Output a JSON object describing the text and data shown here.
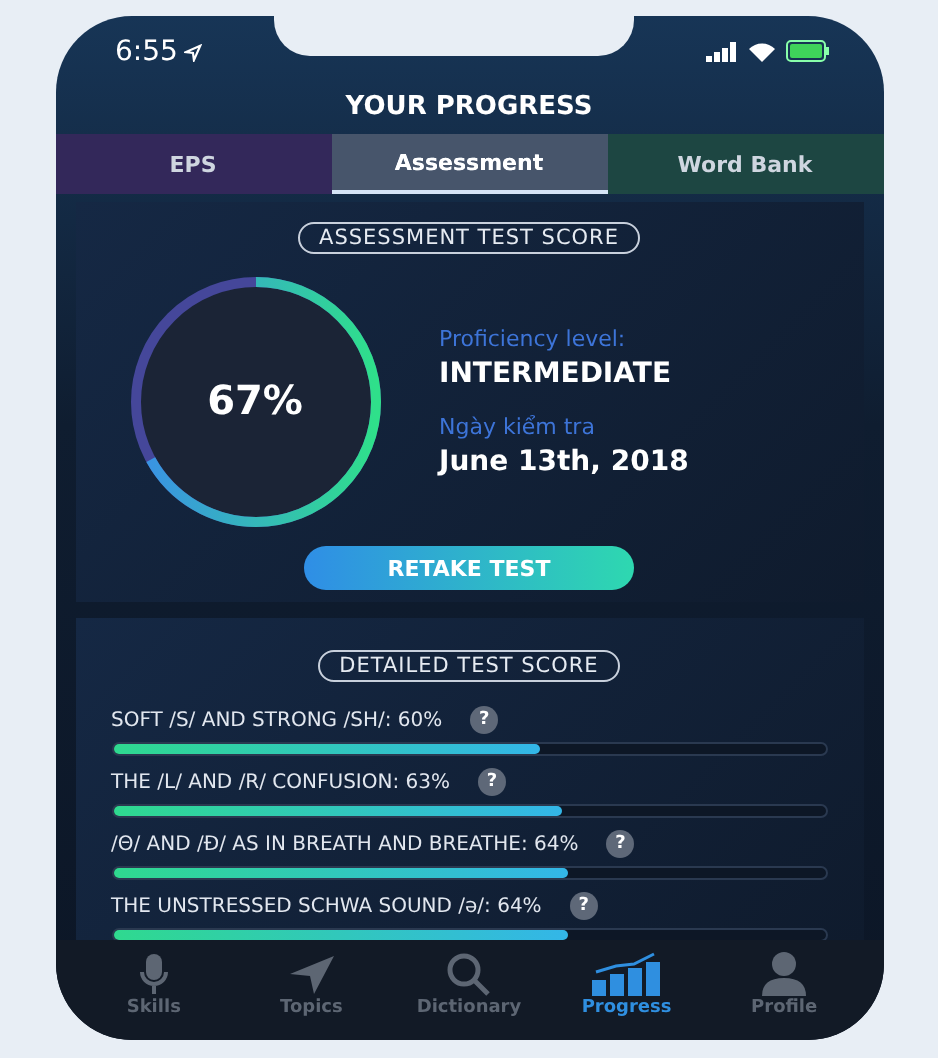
{
  "status_bar": {
    "time": "6:55"
  },
  "title": "YOUR PROGRESS",
  "tabs": [
    {
      "label": "EPS",
      "selected": false,
      "color": "#33285a"
    },
    {
      "label": "Assessment",
      "selected": true,
      "color": "#3e4a5d"
    },
    {
      "label": "Word Bank",
      "selected": false,
      "color": "#1d4642"
    }
  ],
  "score_card": {
    "heading": "ASSESSMENT TEST SCORE",
    "score": "67%",
    "proficiency_label": "Proficiency level:",
    "proficiency": "INTERMEDIATE",
    "date_label": "Ngày kiểm tra",
    "date": "June 13th, 2018",
    "button": "RETAKE TEST"
  },
  "details": {
    "heading": "DETAILED TEST SCORE",
    "items": [
      {
        "label": "SOFT /S/ AND STRONG /SH/:  60%",
        "level": 0.6,
        "help": "?"
      },
      {
        "label": "THE /L/ AND /R/ CONFUSION:  63%",
        "level": 0.63,
        "help": "?"
      },
      {
        "label": "/Θ/ AND /Ð/ AS IN BREATH AND BREATHE:  64%",
        "level": 0.64,
        "help": "?"
      },
      {
        "label": "THE UNSTRESSED SCHWA SOUND /ə/:  64%",
        "level": 0.64,
        "help": "?"
      }
    ]
  },
  "nav": [
    {
      "label": "Skills",
      "kind": "mic",
      "selected": false
    },
    {
      "label": "Topics",
      "kind": "plane",
      "selected": false
    },
    {
      "label": "Dictionary",
      "kind": "search",
      "selected": false
    },
    {
      "label": "Progress",
      "kind": "chart",
      "selected": true
    },
    {
      "label": "Profile",
      "kind": "person",
      "selected": false
    }
  ]
}
